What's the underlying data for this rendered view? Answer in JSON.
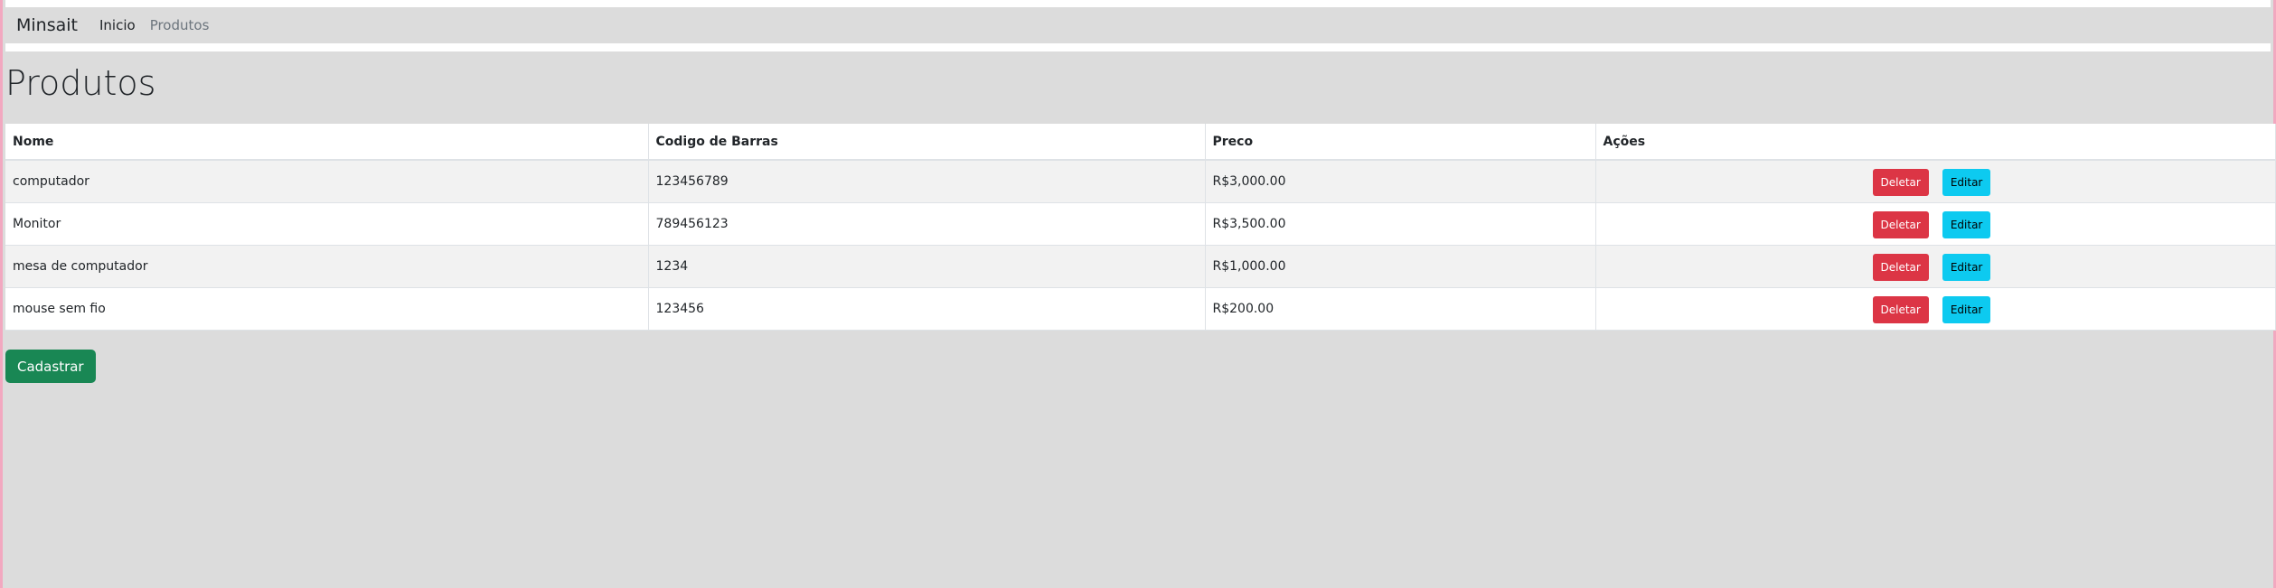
{
  "navbar": {
    "brand": "Minsait",
    "links": [
      {
        "label": "Inicio"
      },
      {
        "label": "Produtos"
      }
    ]
  },
  "page": {
    "title": "Produtos"
  },
  "table": {
    "headers": [
      "Nome",
      "Codigo de Barras",
      "Preco",
      "Ações"
    ],
    "rows": [
      {
        "nome": "computador",
        "codigo": "123456789",
        "preco": "R$3,000.00"
      },
      {
        "nome": "Monitor",
        "codigo": "789456123",
        "preco": "R$3,500.00"
      },
      {
        "nome": "mesa de computador",
        "codigo": "1234",
        "preco": "R$1,000.00"
      },
      {
        "nome": "mouse sem fio",
        "codigo": "123456",
        "preco": "R$200.00"
      }
    ],
    "delete_label": "Deletar",
    "edit_label": "Editar"
  },
  "actions": {
    "register_label": "Cadastrar"
  },
  "colors": {
    "background": "#dcdcdc",
    "danger": "#dc3545",
    "info": "#0dcaf0",
    "success": "#198754"
  }
}
